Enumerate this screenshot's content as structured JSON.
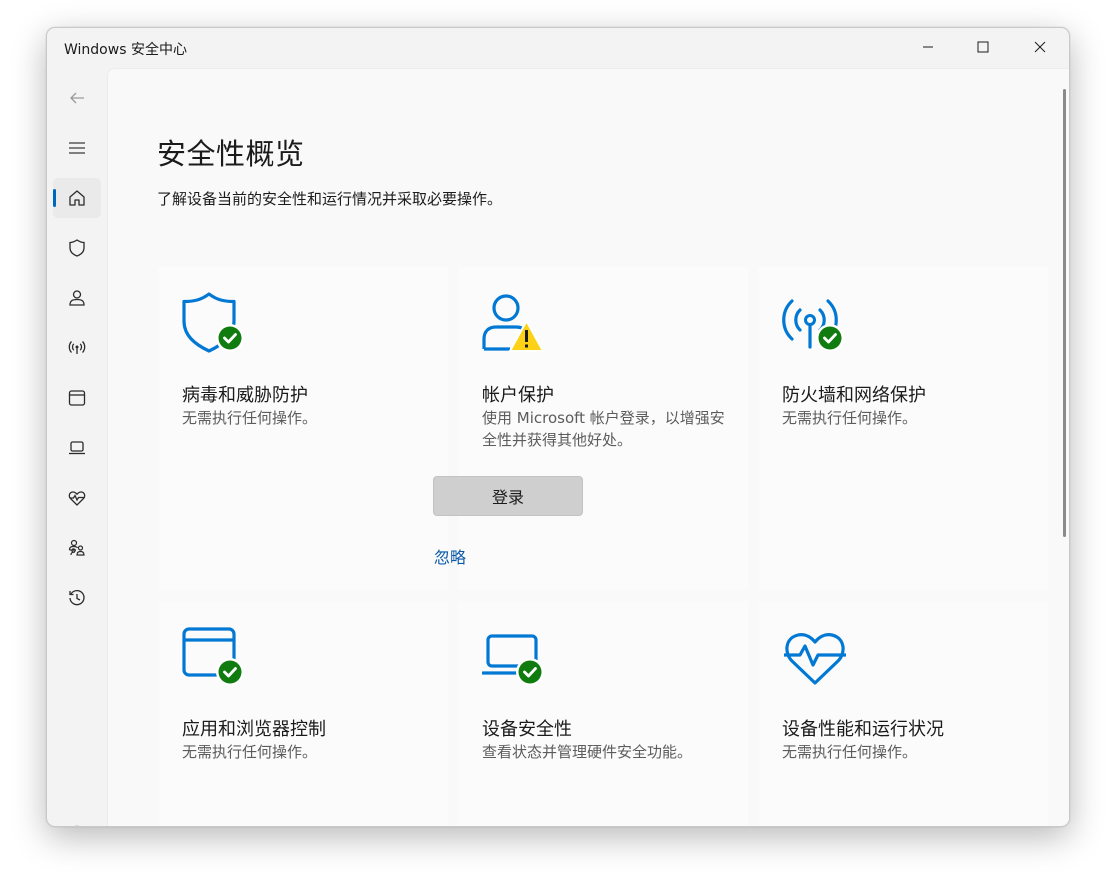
{
  "window": {
    "title": "Windows 安全中心"
  },
  "page": {
    "title": "安全性概览",
    "subtitle": "了解设备当前的安全性和运行情况并采取必要操作。"
  },
  "cards": [
    {
      "title": "病毒和威胁防护",
      "desc": "无需执行任何操作。",
      "status": "ok"
    },
    {
      "title": "帐户保护",
      "desc": "使用 Microsoft 帐户登录，以增强安全性并获得其他好处。",
      "status": "warning",
      "primary_button": "登录",
      "link": "忽略"
    },
    {
      "title": "防火墙和网络保护",
      "desc": "无需执行任何操作。",
      "status": "ok"
    },
    {
      "title": "应用和浏览器控制",
      "desc": "无需执行任何操作。",
      "status": "ok"
    },
    {
      "title": "设备安全性",
      "desc": "查看状态并管理硬件安全功能。",
      "status": "ok"
    },
    {
      "title": "设备性能和运行状况",
      "desc": "无需执行任何操作。",
      "status": "none"
    }
  ],
  "nav": [
    {
      "icon": "back-arrow-icon"
    },
    {
      "icon": "hamburger-menu-icon"
    },
    {
      "icon": "home-icon",
      "selected": true
    },
    {
      "icon": "shield-icon"
    },
    {
      "icon": "person-icon"
    },
    {
      "icon": "wifi-antenna-icon"
    },
    {
      "icon": "app-window-icon"
    },
    {
      "icon": "laptop-icon"
    },
    {
      "icon": "heart-pulse-icon"
    },
    {
      "icon": "family-icon"
    },
    {
      "icon": "history-icon"
    },
    {
      "icon": "settings-gear-icon"
    }
  ],
  "colors": {
    "accent": "#0067c0",
    "icon_blue": "#0078d4",
    "ok_green": "#107c10",
    "warning_yellow": "#fcd116",
    "link": "#0b5aa8"
  }
}
